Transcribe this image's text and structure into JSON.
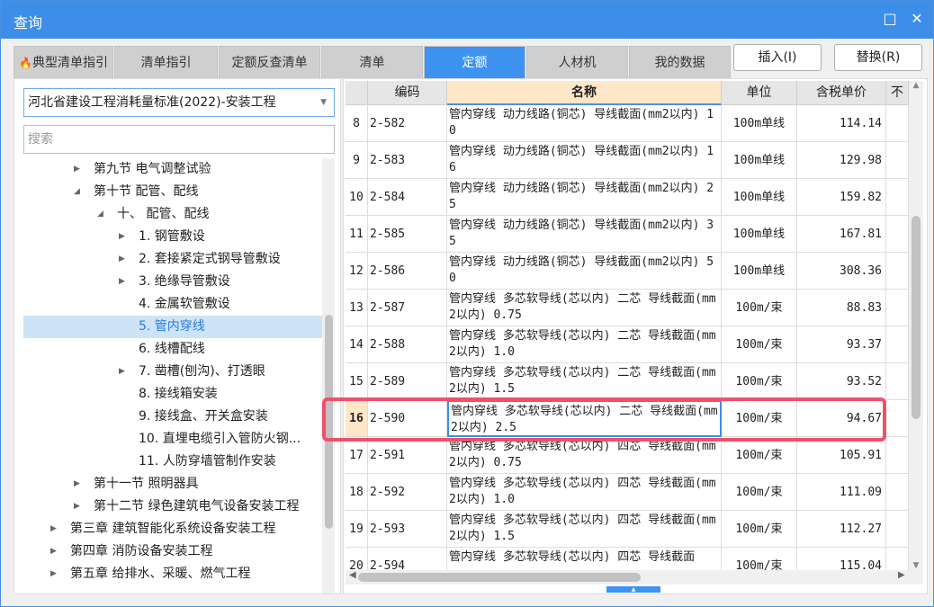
{
  "window": {
    "title": "查询",
    "restore_icon": "□",
    "close_icon": "✕"
  },
  "tabs": [
    {
      "label": "典型清单指引",
      "icon": "fire-icon"
    },
    {
      "label": "清单指引"
    },
    {
      "label": "定额反查清单"
    },
    {
      "label": "清单"
    },
    {
      "label": "定额",
      "active": true
    },
    {
      "label": "人材机"
    },
    {
      "label": "我的数据"
    }
  ],
  "actions": {
    "insert": "插入(I)",
    "replace": "替换(R)"
  },
  "left": {
    "standard": "河北省建设工程消耗量标准(2022)-安装工程",
    "search_placeholder": "搜索",
    "tree": [
      {
        "label": "第九节 电气调整试验",
        "level": 2,
        "arrow": "right"
      },
      {
        "label": "第十节 配管、配线",
        "level": 2,
        "arrow": "down"
      },
      {
        "label": "十、 配管、配线",
        "level": 3,
        "arrow": "down"
      },
      {
        "label": "1. 钢管敷设",
        "level": 4,
        "arrow": "right"
      },
      {
        "label": "2. 套接紧定式钢导管敷设",
        "level": 4,
        "arrow": "right"
      },
      {
        "label": "3. 绝缘导管敷设",
        "level": 4,
        "arrow": "right"
      },
      {
        "label": "4. 金属软管敷设",
        "level": 4
      },
      {
        "label": "5. 管内穿线",
        "level": 4,
        "selected": true
      },
      {
        "label": "6. 线槽配线",
        "level": 4
      },
      {
        "label": "7. 凿槽(刨沟)、打透眼",
        "level": 4,
        "arrow": "right"
      },
      {
        "label": "8. 接线箱安装",
        "level": 4
      },
      {
        "label": "9. 接线盒、开关盒安装",
        "level": 4
      },
      {
        "label": "10. 直埋电缆引入管防火钢...",
        "level": 4
      },
      {
        "label": "11. 人防穿墙管制作安装",
        "level": 4
      },
      {
        "label": "第十一节 照明器具",
        "level": 2,
        "arrow": "right"
      },
      {
        "label": "第十二节 绿色建筑电气设备安装工程",
        "level": 2,
        "arrow": "right"
      },
      {
        "label": "第三章 建筑智能化系统设备安装工程",
        "level": 1,
        "arrow": "right"
      },
      {
        "label": "第四章 消防设备安装工程",
        "level": 1,
        "arrow": "right"
      },
      {
        "label": "第五章 给排水、采暖、燃气工程",
        "level": 1,
        "arrow": "right"
      }
    ]
  },
  "grid": {
    "headers": {
      "code": "编码",
      "name": "名称",
      "unit": "单位",
      "price": "含税单价",
      "extra": "不"
    },
    "rows": [
      {
        "n": "8",
        "code": "2-582",
        "name": "管内穿线 动力线路(铜芯) 导线截面(mm2以内) 10",
        "unit": "100m单线",
        "price": "114.14"
      },
      {
        "n": "9",
        "code": "2-583",
        "name": "管内穿线 动力线路(铜芯) 导线截面(mm2以内) 16",
        "unit": "100m单线",
        "price": "129.98"
      },
      {
        "n": "10",
        "code": "2-584",
        "name": "管内穿线 动力线路(铜芯) 导线截面(mm2以内) 25",
        "unit": "100m单线",
        "price": "159.82"
      },
      {
        "n": "11",
        "code": "2-585",
        "name": "管内穿线 动力线路(铜芯) 导线截面(mm2以内) 35",
        "unit": "100m单线",
        "price": "167.81"
      },
      {
        "n": "12",
        "code": "2-586",
        "name": "管内穿线 动力线路(铜芯) 导线截面(mm2以内) 50",
        "unit": "100m单线",
        "price": "308.36"
      },
      {
        "n": "13",
        "code": "2-587",
        "name": "管内穿线 多芯软导线(芯以内) 二芯 导线截面(mm2以内) 0.75",
        "unit": "100m/束",
        "price": "88.83"
      },
      {
        "n": "14",
        "code": "2-588",
        "name": "管内穿线 多芯软导线(芯以内) 二芯 导线截面(mm2以内) 1.0",
        "unit": "100m/束",
        "price": "93.37"
      },
      {
        "n": "15",
        "code": "2-589",
        "name": "管内穿线 多芯软导线(芯以内) 二芯 导线截面(mm2以内) 1.5",
        "unit": "100m/束",
        "price": "93.52"
      },
      {
        "n": "16",
        "code": "2-590",
        "name": "管内穿线 多芯软导线(芯以内) 二芯 导线截面(mm2以内) 2.5",
        "unit": "100m/束",
        "price": "94.67",
        "selected": true
      },
      {
        "n": "17",
        "code": "2-591",
        "name": "管内穿线 多芯软导线(芯以内) 四芯 导线截面(mm2以内) 0.75",
        "unit": "100m/束",
        "price": "105.91"
      },
      {
        "n": "18",
        "code": "2-592",
        "name": "管内穿线 多芯软导线(芯以内) 四芯 导线截面(mm2以内) 1.0",
        "unit": "100m/束",
        "price": "111.09"
      },
      {
        "n": "19",
        "code": "2-593",
        "name": "管内穿线 多芯软导线(芯以内) 四芯 导线截面(mm2以内) 1.5",
        "unit": "100m/束",
        "price": "112.27"
      },
      {
        "n": "20",
        "code": "2-594",
        "name": "管内穿线 多芯软导线(芯以内) 四芯 导线截面",
        "unit": "100m/束",
        "price": "115.04"
      }
    ]
  },
  "colors": {
    "accent": "#3d8ee8",
    "highlight": "#f0506a",
    "header_active": "#fde7c8"
  }
}
